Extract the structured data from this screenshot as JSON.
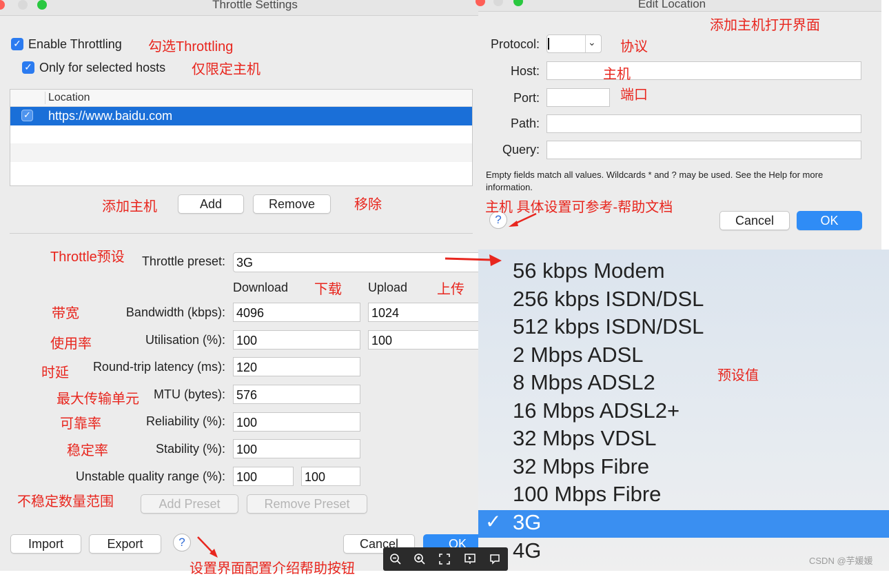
{
  "throttle_window": {
    "title": "Throttle Settings",
    "enable_throttling": {
      "label": "Enable Throttling",
      "checked": true
    },
    "only_selected_hosts": {
      "label": "Only for selected hosts",
      "checked": true
    },
    "table": {
      "header": "Location",
      "rows": [
        {
          "checked": true,
          "url": "https://www.baidu.com"
        }
      ]
    },
    "add_label": "Add",
    "remove_label": "Remove",
    "preset_label": "Throttle preset:",
    "preset_value": "3G",
    "download_header": "Download",
    "upload_header": "Upload",
    "fields": {
      "bandwidth": {
        "label": "Bandwidth (kbps):",
        "download": "4096",
        "upload": "1024"
      },
      "utilisation": {
        "label": "Utilisation (%):",
        "download": "100",
        "upload": "100"
      },
      "latency": {
        "label": "Round-trip latency (ms):",
        "value": "120"
      },
      "mtu": {
        "label": "MTU (bytes):",
        "value": "576"
      },
      "reliability": {
        "label": "Reliability (%):",
        "value": "100"
      },
      "stability": {
        "label": "Stability (%):",
        "value": "100"
      },
      "unstable": {
        "label": "Unstable quality range (%):",
        "value1": "100",
        "value2": "100"
      }
    },
    "add_preset_label": "Add Preset",
    "remove_preset_label": "Remove Preset",
    "import_label": "Import",
    "export_label": "Export",
    "help_label": "?",
    "cancel_label": "Cancel",
    "ok_label": "OK"
  },
  "edit_location_window": {
    "title": "Edit Location",
    "protocol_label": "Protocol:",
    "host_label": "Host:",
    "port_label": "Port:",
    "path_label": "Path:",
    "query_label": "Query:",
    "info_text": "Empty fields match all values. Wildcards * and ? may be used. See the Help for more information.",
    "help_label": "?",
    "cancel_label": "Cancel",
    "ok_label": "OK"
  },
  "preset_menu": {
    "items": [
      {
        "label": "56 kbps Modem",
        "selected": false
      },
      {
        "label": "256 kbps ISDN/DSL",
        "selected": false
      },
      {
        "label": "512 kbps ISDN/DSL",
        "selected": false
      },
      {
        "label": "2 Mbps ADSL",
        "selected": false
      },
      {
        "label": "8 Mbps ADSL2",
        "selected": false
      },
      {
        "label": "16 Mbps ADSL2+",
        "selected": false
      },
      {
        "label": "32 Mbps VDSL",
        "selected": false
      },
      {
        "label": "32 Mbps Fibre",
        "selected": false
      },
      {
        "label": "100 Mbps Fibre",
        "selected": false
      },
      {
        "label": "3G",
        "selected": true
      },
      {
        "label": "4G",
        "selected": false
      }
    ],
    "check_mark": "✓"
  },
  "annotations": {
    "enable_throttling": "勾选Throttling",
    "only_hosts": "仅限定主机",
    "add_host": "添加主机",
    "remove": "移除",
    "preset": "Throttle预设",
    "download": "下载",
    "upload": "上传",
    "bandwidth": "带宽",
    "utilisation": "使用率",
    "latency": "时延",
    "mtu": "最大传输单元",
    "reliability": "可靠率",
    "stability": "稳定率",
    "unstable": "不稳定数量范围",
    "help_button": "设置界面配置介绍帮助按钮",
    "edit_title": "添加主机打开界面",
    "protocol": "协议",
    "host": "主机",
    "port": "端口",
    "help_doc": "主机 具体设置可参考-帮助文档",
    "preset_values": "预设值"
  },
  "viewer_toolbar": {
    "icons": [
      "zoom-out-icon",
      "zoom-in-icon",
      "fullscreen-icon",
      "slideshow-icon",
      "comment-icon"
    ]
  },
  "watermark": "CSDN @芋媛媛",
  "colors": {
    "annotation_red": "#e8261e",
    "selection_blue": "#1a6fd8",
    "menu_selection_blue": "#3a8ff1",
    "checkbox_blue": "#2b7bf0"
  }
}
